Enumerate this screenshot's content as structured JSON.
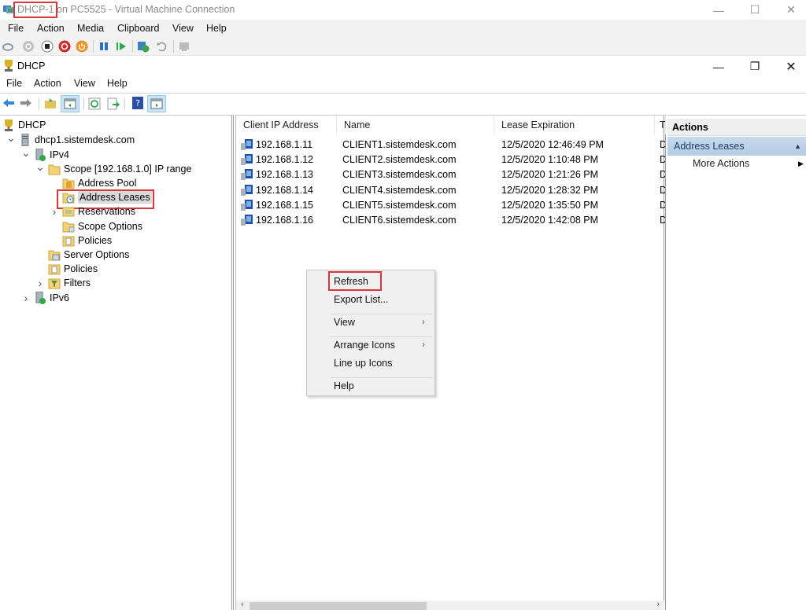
{
  "vm_window": {
    "title": "DHCP-1 on PC5525 - Virtual Machine Connection",
    "menu": [
      "File",
      "Action",
      "Media",
      "Clipboard",
      "View",
      "Help"
    ],
    "toolbar_icons": [
      "ctrl-alt-del-icon",
      "start-icon",
      "turn-off-icon",
      "shutdown-icon",
      "power-icon",
      "pause-icon",
      "resume-icon",
      "checkpoint-icon",
      "revert-icon",
      "enhanced-session-icon"
    ],
    "controls": {
      "minimize": "—",
      "maximize": "☐",
      "close": "✕"
    }
  },
  "mmc_window": {
    "title": "DHCP",
    "menu": [
      "File",
      "Action",
      "View",
      "Help"
    ],
    "toolbar_icons": [
      "back-icon",
      "forward-icon",
      "up-folder-icon",
      "show-hide-tree-icon",
      "refresh-icon",
      "export-list-icon",
      "help-icon",
      "show-hide-action-pane-icon"
    ],
    "controls": {
      "minimize": "—",
      "restore": "❐",
      "close": "✕"
    }
  },
  "tree": [
    {
      "label": "DHCP",
      "level": 0,
      "expander": "",
      "icon": "dhcp-root-icon"
    },
    {
      "label": "dhcp1.sistemdesk.com",
      "level": 1,
      "expander": "expanded",
      "icon": "server-icon"
    },
    {
      "label": "IPv4",
      "level": 2,
      "expander": "expanded",
      "icon": "ipv4-icon"
    },
    {
      "label": "Scope [192.168.1.0] IP range",
      "level": 3,
      "expander": "expanded",
      "icon": "scope-folder-icon"
    },
    {
      "label": "Address Pool",
      "level": 4,
      "expander": "",
      "icon": "address-pool-icon"
    },
    {
      "label": "Address Leases",
      "level": 4,
      "expander": "",
      "icon": "address-leases-icon",
      "selected": true
    },
    {
      "label": "Reservations",
      "level": 4,
      "expander": "collapsed",
      "icon": "reservations-icon"
    },
    {
      "label": "Scope Options",
      "level": 4,
      "expander": "",
      "icon": "scope-options-icon"
    },
    {
      "label": "Policies",
      "level": 4,
      "expander": "",
      "icon": "policies-icon"
    },
    {
      "label": "Server Options",
      "level": 3,
      "expander": "",
      "icon": "server-options-icon"
    },
    {
      "label": "Policies",
      "level": 3,
      "expander": "",
      "icon": "policies-icon"
    },
    {
      "label": "Filters",
      "level": 3,
      "expander": "collapsed",
      "icon": "filters-icon"
    },
    {
      "label": "IPv6",
      "level": 2,
      "expander": "collapsed",
      "icon": "ipv6-icon"
    }
  ],
  "list": {
    "columns": [
      "Client IP Address",
      "Name",
      "Lease Expiration",
      "T"
    ],
    "rows": [
      {
        "ip": "192.168.1.11",
        "name": "CLIENT1.sistemdesk.com",
        "expiration": "12/5/2020 12:46:49 PM",
        "type": "D"
      },
      {
        "ip": "192.168.1.12",
        "name": "CLIENT2.sistemdesk.com",
        "expiration": "12/5/2020 1:10:48 PM",
        "type": "D"
      },
      {
        "ip": "192.168.1.13",
        "name": "CLIENT3.sistemdesk.com",
        "expiration": "12/5/2020 1:21:26 PM",
        "type": "D"
      },
      {
        "ip": "192.168.1.14",
        "name": "CLIENT4.sistemdesk.com",
        "expiration": "12/5/2020 1:28:32 PM",
        "type": "D"
      },
      {
        "ip": "192.168.1.15",
        "name": "CLIENT5.sistemdesk.com",
        "expiration": "12/5/2020 1:35:50 PM",
        "type": "D"
      },
      {
        "ip": "192.168.1.16",
        "name": "CLIENT6.sistemdesk.com",
        "expiration": "12/5/2020 1:42:08 PM",
        "type": "D"
      }
    ]
  },
  "actions": {
    "header": "Actions",
    "section": "Address Leases",
    "section_arrow": "▲",
    "items": [
      {
        "label": "More Actions",
        "arrow": "▶"
      }
    ]
  },
  "context_menu": {
    "items": [
      {
        "label": "Refresh",
        "highlighted": true
      },
      {
        "label": "Export List..."
      },
      {
        "separator": true
      },
      {
        "label": "View",
        "submenu": true
      },
      {
        "separator": true
      },
      {
        "label": "Arrange Icons",
        "submenu": true
      },
      {
        "label": "Line up Icons"
      },
      {
        "separator": true
      },
      {
        "label": "Help"
      }
    ],
    "submenu_arrow": "›"
  },
  "scrollbar": {
    "left_arrow": "‹",
    "right_arrow": "›",
    "position_fraction": 0.0,
    "visible_fraction": 0.42
  },
  "colors": {
    "highlight_box": "#d9373a",
    "action_section": "#c3d6ea",
    "selected_item": "#d9d9d9"
  }
}
